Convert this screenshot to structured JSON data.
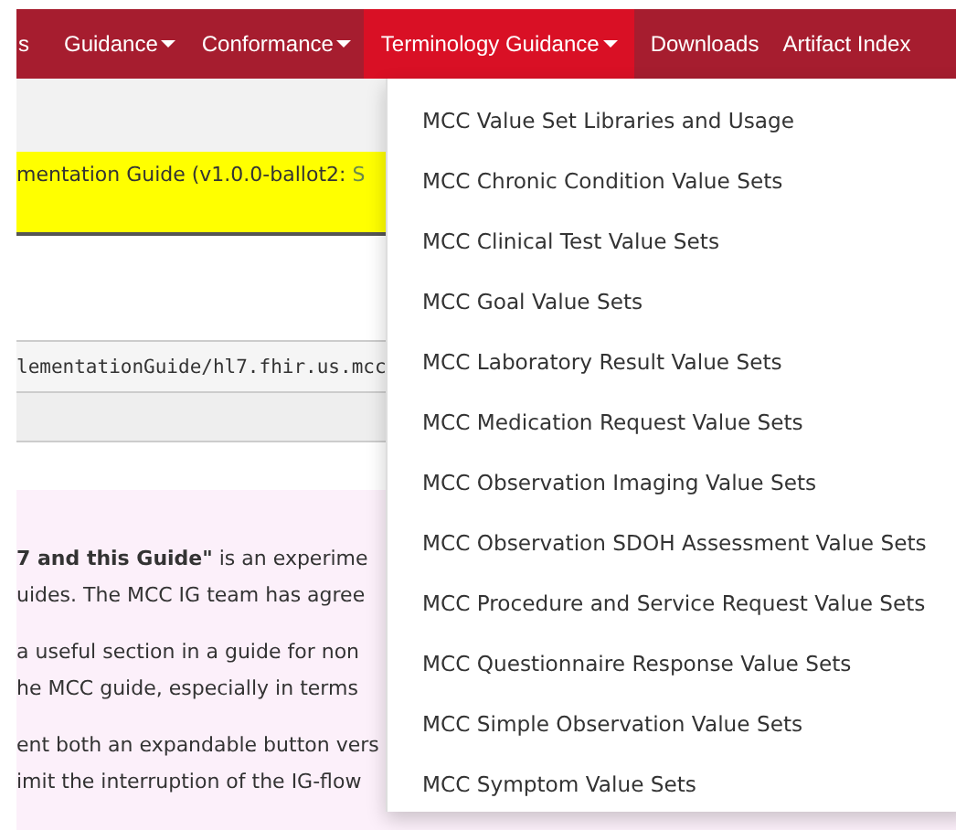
{
  "nav": {
    "items": [
      {
        "label": "s",
        "dropdown": false,
        "selected": false
      },
      {
        "label": "Guidance",
        "dropdown": true,
        "selected": false
      },
      {
        "label": "Conformance",
        "dropdown": true,
        "selected": false
      },
      {
        "label": "Terminology Guidance",
        "dropdown": true,
        "selected": true
      },
      {
        "label": "Downloads",
        "dropdown": false,
        "selected": false
      },
      {
        "label": "Artifact Index",
        "dropdown": false,
        "selected": false
      }
    ]
  },
  "banner": {
    "text": "mentation Guide (v1.0.0-ballot2: ",
    "link": "S"
  },
  "code_url": "lementationGuide/hl7.fhir.us.mcc",
  "note": {
    "paragraphs": [
      [
        "**7 and this Guide\"** is an experime",
        "uides. The MCC IG team has agree"
      ],
      [
        "a useful section in a guide for non",
        "he MCC guide, especially in terms"
      ],
      [
        "ent both an expandable button vers",
        "imit the interruption of the IG-flow"
      ]
    ]
  },
  "dropdown_menu": {
    "items": [
      "MCC Value Set Libraries and Usage",
      "MCC Chronic Condition Value Sets",
      "MCC Clinical Test Value Sets",
      "MCC Goal Value Sets",
      "MCC Laboratory Result Value Sets",
      "MCC Medication Request Value Sets",
      "MCC Observation Imaging Value Sets",
      "MCC Observation SDOH Assessment Value Sets",
      "MCC Procedure and Service Request Value Sets",
      "MCC Questionnaire Response Value Sets",
      "MCC Simple Observation Value Sets",
      "MCC Symptom Value Sets"
    ]
  }
}
